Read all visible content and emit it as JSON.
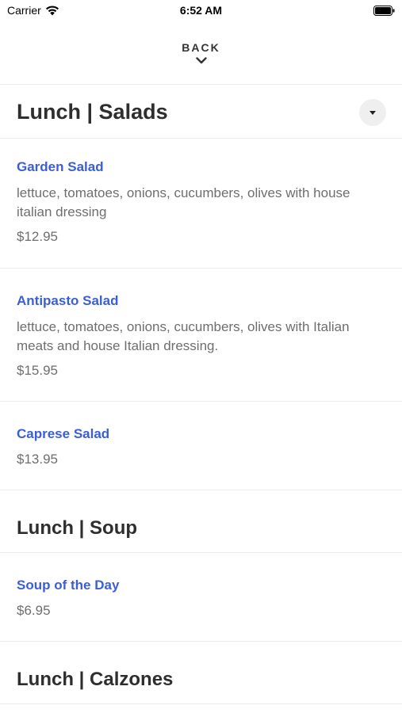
{
  "status_bar": {
    "carrier": "Carrier",
    "time": "6:52 AM",
    "icons": [
      "wifi-icon",
      "battery-icon"
    ]
  },
  "nav": {
    "back_label": "BACK",
    "back_icon": "chevron-down-icon"
  },
  "sections": [
    {
      "title": "Lunch | Salads",
      "toggle_icon": "caret-down-icon",
      "items": [
        {
          "name": "Garden Salad",
          "description": "lettuce, tomatoes, onions, cucumbers, olives with house italian dressing",
          "price": "$12.95"
        },
        {
          "name": "Antipasto Salad",
          "description": "lettuce, tomatoes, onions, cucumbers, olives with Italian meats and house Italian dressing.",
          "price": "$15.95"
        },
        {
          "name": "Caprese Salad",
          "description": "",
          "price": "$13.95"
        }
      ]
    },
    {
      "title": "Lunch | Soup",
      "items": [
        {
          "name": "Soup of the Day",
          "description": "",
          "price": "$6.95"
        }
      ]
    },
    {
      "title": "Lunch | Calzones",
      "items": []
    }
  ],
  "colors": {
    "item_name": "#3b5ed6",
    "muted_text": "#6e6e6e",
    "heading": "#2e2e2e",
    "divider": "#ececec"
  }
}
